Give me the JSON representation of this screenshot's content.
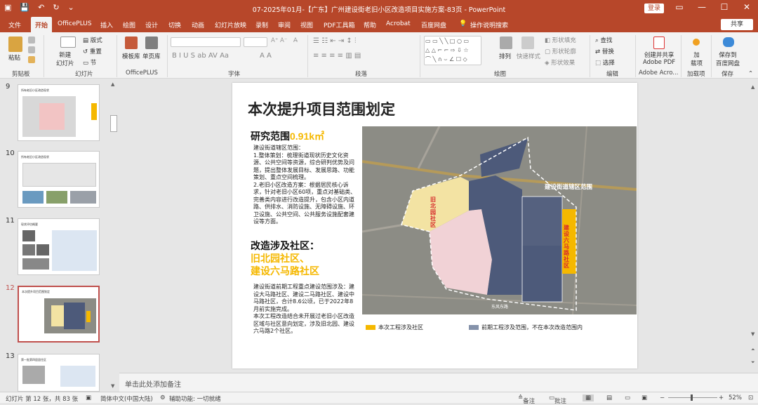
{
  "titlebar": {
    "title": "07-2025年01月-【广东】广州建设街老旧小区改造项目实施方案-83页  -  PowerPoint",
    "login": "登录"
  },
  "tabs": [
    "文件",
    "开始",
    "OfficePLUS",
    "插入",
    "绘图",
    "设计",
    "切换",
    "动画",
    "幻灯片放映",
    "录制",
    "审阅",
    "视图",
    "PDF工具箱",
    "帮助",
    "Acrobat",
    "百度网盘",
    "操作说明搜索"
  ],
  "share": "共享",
  "ribbon": {
    "paste": "粘贴",
    "new_slide": "新建\n幻灯片",
    "layout": "版式",
    "reset": "重置",
    "section": "节",
    "template": "模板库",
    "single_page": "单页库",
    "find": "查找",
    "replace": "替换",
    "select": "选择",
    "arrange": "排列",
    "quick_styles": "快速样式",
    "shape_fill": "形状填充",
    "shape_outline": "形状轮廓",
    "shape_effect": "形状效果",
    "create_pdf": "创建并共享\nAdobe PDF",
    "addin": "加\n载项",
    "baidu_save": "保存到\n百度网盘",
    "groups": [
      "剪贴板",
      "幻灯片",
      "OfficePLUS",
      "字体",
      "段落",
      "绘图",
      "编辑",
      "Adobe Acro...",
      "加载项",
      "保存"
    ]
  },
  "thumbnails": [
    {
      "num": "9",
      "title": "所有老旧小区改造现状"
    },
    {
      "num": "10",
      "title": "所有老旧小区改造现状"
    },
    {
      "num": "11",
      "title": "现状评估概要"
    },
    {
      "num": "12",
      "title": "本次提升项目范围划定"
    },
    {
      "num": "13",
      "title": "第一批第四居居住区"
    }
  ],
  "slide": {
    "title": "本次提升项目范围划定",
    "sec1_head": "研究范围",
    "sec1_value": "0.91k㎡",
    "sec1_body": "建设街道辖区范围：\n1.整体策划：梳理街道现状历史文化资源、公共空间等资源，综合研判优势及问题，提出整体发展目标、发展思路、功能策划、重点空间梳理。\n2.老旧小区改造方案：根据居民核心诉求，针对老旧小区60项，重点对基础类、完善类内容进行改造提升，包含小区内道路、供排水、消防设施、无障碍设施、环卫设施、公共空间、公共服务设施配套建设等方面。",
    "sec2_head": "改造涉及社区：",
    "sec2_line1": "旧北园社区、",
    "sec2_line2": "建设六马路社区",
    "sec2_body": "建设街道前期工程重点建设范围涉及：建设大马路社区、建设二马路社区、建设中马路社区，合计8.6公顷，已于2022年8月前实施完成。\n本次工程改造结合未开展过老旧小区改造区域与社区意向划定，涉及旧北园、建设六马路2个社区。",
    "map_label_range": "建设街道辖区范围",
    "map_label_jbw": "旧北园社区",
    "map_label_js6": "建设六马路社区",
    "map_label_east": "东风东路",
    "legend1": "本次工程涉及社区",
    "legend2": "前期工程涉及范围，不在本次改造范围内"
  },
  "notes": "单击此处添加备注",
  "status": {
    "slide_info": "幻灯片 第 12 张，共 83 张",
    "lang": "简体中文(中国大陆)",
    "access": "辅助功能: 一切就绪",
    "notes": "备注",
    "comments": "批注",
    "zoom": "52%"
  },
  "colors": {
    "accent": "#b7472a",
    "yellow": "#f5b800",
    "navy": "#4d5a7a",
    "gray_map": "#8c8c85"
  }
}
